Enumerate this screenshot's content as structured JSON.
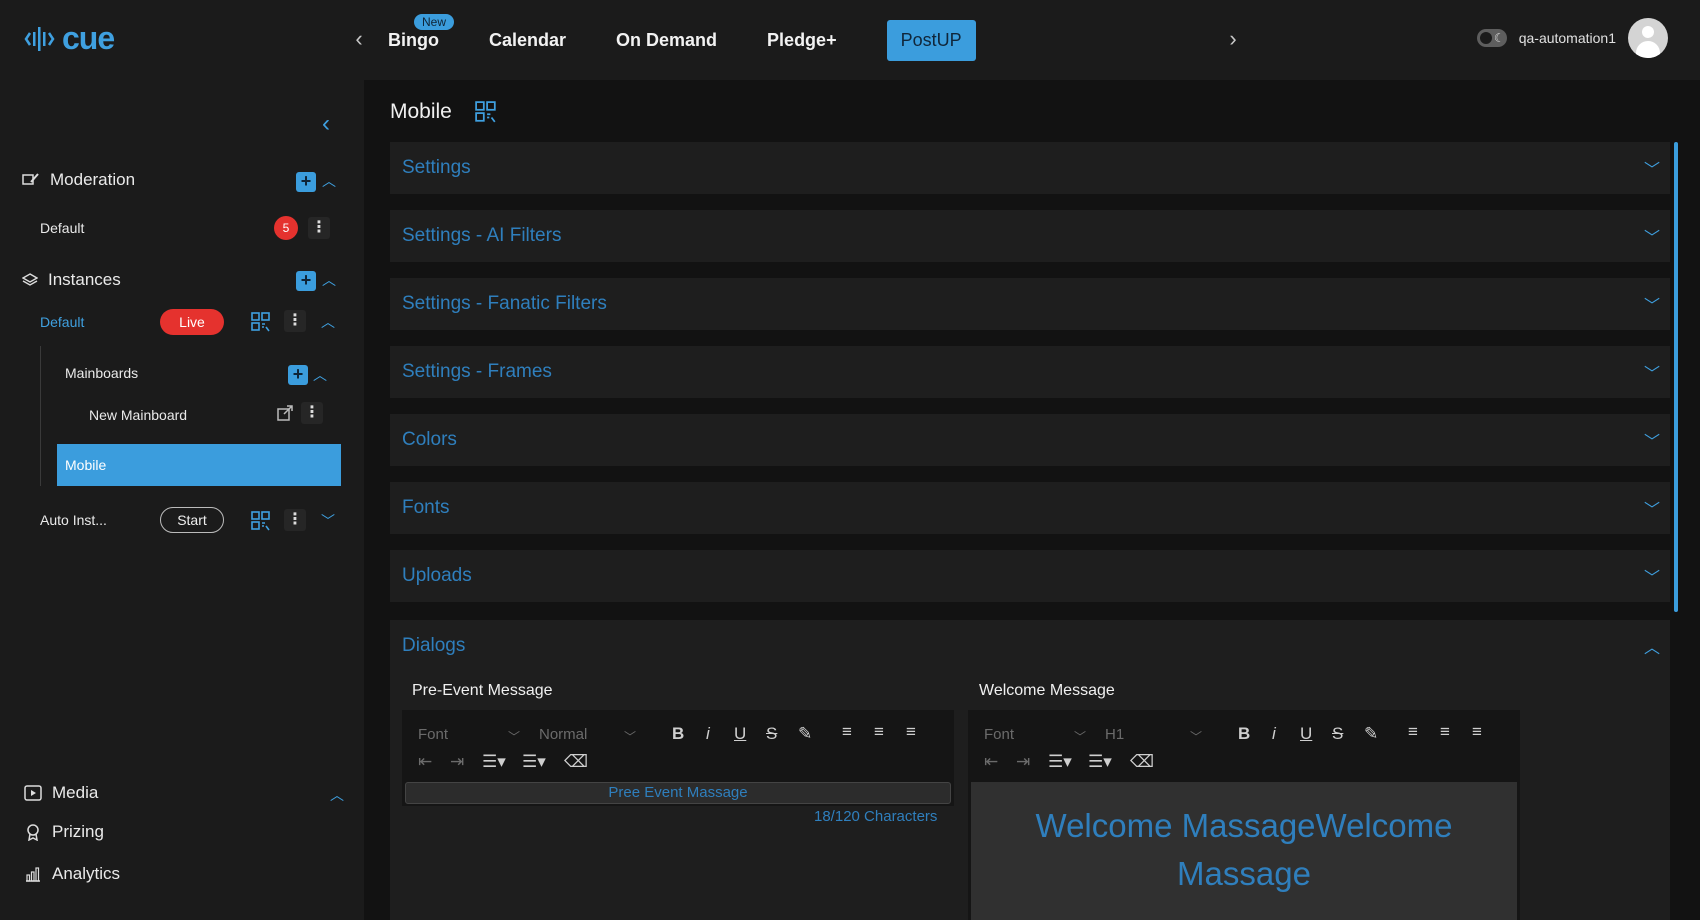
{
  "app": {
    "logo_text": "cue",
    "nav_tabs": [
      "Bingo",
      "Calendar",
      "On Demand",
      "Pledge+",
      "PostUP"
    ],
    "new_badge": "New",
    "username": "qa-automation1"
  },
  "sidebar": {
    "moderation": {
      "label": "Moderation",
      "default_label": "Default",
      "default_count": "5"
    },
    "instances": {
      "label": "Instances",
      "default_label": "Default",
      "live_label": "Live",
      "mainboards_label": "Mainboards",
      "new_mainboard_label": "New Mainboard",
      "mobile_label": "Mobile",
      "auto_label": "Auto Inst...",
      "start_label": "Start"
    },
    "bottom": [
      "Media",
      "Prizing",
      "Analytics"
    ]
  },
  "main": {
    "title": "Mobile",
    "sections": [
      "Settings",
      "Settings - AI Filters",
      "Settings - Fanatic Filters",
      "Settings - Frames",
      "Colors",
      "Fonts",
      "Uploads",
      "Dialogs"
    ],
    "pre_event": {
      "title": "Pre-Event Message",
      "font": "Font",
      "size": "Normal",
      "text": "Pree Event Massage",
      "char_count": "18/120 Characters"
    },
    "welcome": {
      "title": "Welcome Message",
      "font": "Font",
      "size": "H1",
      "text": "Welcome MassageWelcome Massage"
    }
  },
  "colors": {
    "accent": "#3b9ddd",
    "live": "#e5322e",
    "section_text": "#2f7fbd"
  },
  "icons": [
    "chevron-left-icon",
    "chevron-right-icon",
    "moderation-icon",
    "layers-icon",
    "qr-code-icon",
    "external-link-icon",
    "media-icon",
    "award-icon",
    "bar-chart-icon",
    "theme-toggle-icon",
    "user-icon"
  ]
}
